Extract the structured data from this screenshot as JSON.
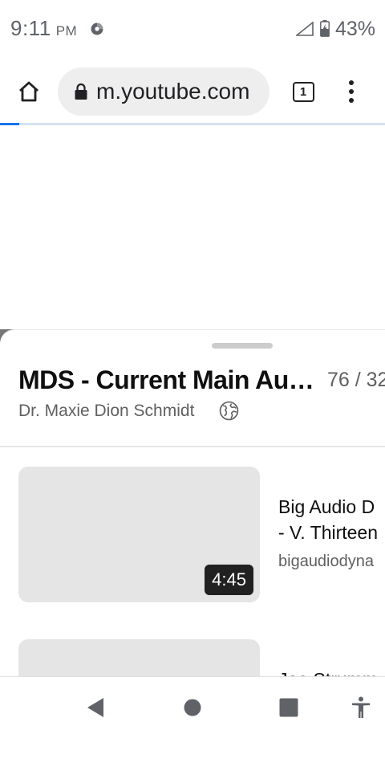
{
  "status_bar": {
    "time": "9:11",
    "ampm": "PM",
    "battery": "43%",
    "icons": [
      "media-notification-icon",
      "signal-icon",
      "battery-icon"
    ]
  },
  "browser": {
    "url": "m.youtube.com",
    "tab_count": "1",
    "icons": [
      "home-icon",
      "lock-icon",
      "tab-switcher-icon",
      "more-vert-icon"
    ],
    "load_progress": 0.05,
    "accent_color": "#1a73e8"
  },
  "playlist": {
    "title": "MDS - Current Main Audio Playlist",
    "position": "76 / 32",
    "owner": "Dr. Maxie Dion Schmidt",
    "visibility_icon": "globe-icon",
    "items": [
      {
        "title": "Big Audio D\n- V. Thirteen",
        "channel": "bigaudiodyna",
        "duration": "4:45"
      },
      {
        "title": "Joe Strumm",
        "channel": "",
        "duration": ""
      }
    ]
  },
  "nav_bar": {
    "icons": [
      "back-icon",
      "home-circle-icon",
      "recents-icon",
      "accessibility-icon"
    ]
  }
}
